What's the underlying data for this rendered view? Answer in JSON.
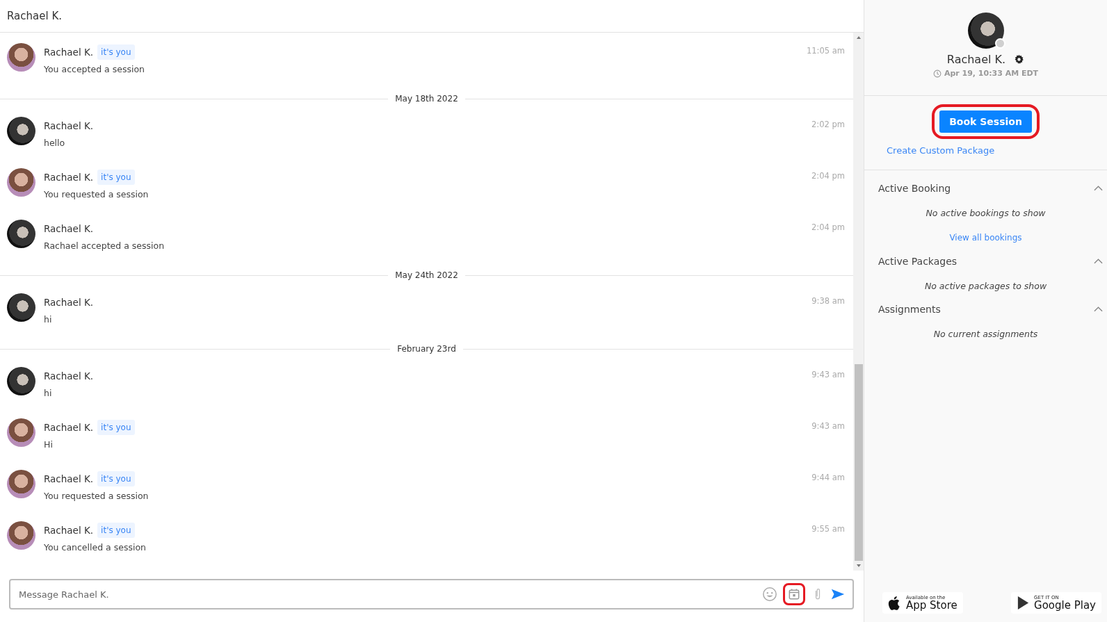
{
  "header": {
    "title": "Rachael K."
  },
  "messages": [
    {
      "kind": "message",
      "sender": "Rachael K.",
      "badge": "it's you",
      "text": "You accepted a session",
      "time": "11:05 am"
    },
    {
      "kind": "divider",
      "label": "May 18th 2022"
    },
    {
      "kind": "message",
      "sender": "Rachael K.",
      "text": "hello",
      "time": "2:02 pm"
    },
    {
      "kind": "message",
      "sender": "Rachael K.",
      "badge": "it's you",
      "text": "You requested a session",
      "time": "2:04 pm"
    },
    {
      "kind": "message",
      "sender": "Rachael K.",
      "text": "Rachael accepted a session",
      "time": "2:04 pm"
    },
    {
      "kind": "divider",
      "label": "May 24th 2022"
    },
    {
      "kind": "message",
      "sender": "Rachael K.",
      "text": "hi",
      "time": "9:38 am"
    },
    {
      "kind": "divider",
      "label": "February 23rd"
    },
    {
      "kind": "message",
      "sender": "Rachael K.",
      "text": "hi",
      "time": "9:43 am"
    },
    {
      "kind": "message",
      "sender": "Rachael K.",
      "badge": "it's you",
      "text": "Hi",
      "time": "9:43 am"
    },
    {
      "kind": "message",
      "sender": "Rachael K.",
      "badge": "it's you",
      "text": "You requested a session",
      "time": "9:44 am"
    },
    {
      "kind": "message",
      "sender": "Rachael K.",
      "badge": "it's you",
      "text": "You cancelled a session",
      "time": "9:55 am"
    }
  ],
  "composer": {
    "placeholder": "Message Rachael K.",
    "calendar_highlighted": true
  },
  "profile": {
    "name": "Rachael K.",
    "online": false,
    "local_time": "Apr 19, 10:33 AM EDT"
  },
  "actions": {
    "book_button": "Book Session",
    "book_highlighted": true,
    "custom_package_link": "Create Custom Package"
  },
  "sections": [
    {
      "title": "Active Booking",
      "expanded": true,
      "empty_text": "No active bookings to show",
      "link": "View all bookings"
    },
    {
      "title": "Active Packages",
      "expanded": true,
      "empty_text": "No active packages to show"
    },
    {
      "title": "Assignments",
      "expanded": true,
      "empty_text": "No current assignments"
    }
  ],
  "app_badges": [
    {
      "kind": "apple",
      "small": "Available on the",
      "large": "App Store"
    },
    {
      "kind": "google",
      "small": "GET IT ON",
      "large": "Google Play"
    }
  ]
}
